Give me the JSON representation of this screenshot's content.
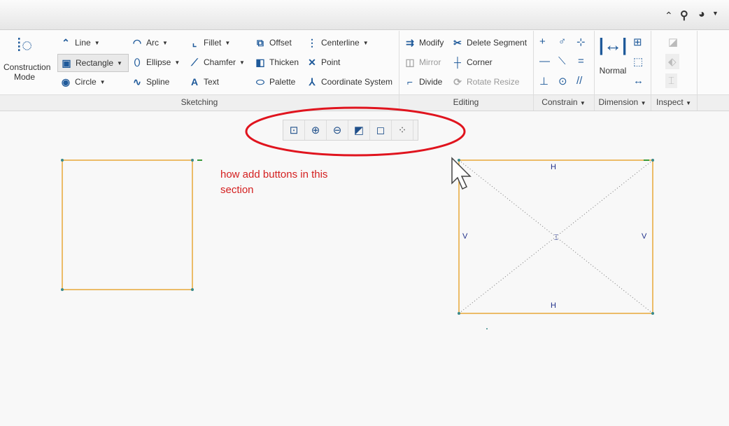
{
  "topbar": {
    "icons": [
      "collapse-ribbon-icon",
      "search-icon",
      "help-icon"
    ]
  },
  "ribbon": {
    "construction_mode": "Construction Mode",
    "sketching": {
      "label": "Sketching",
      "col1": [
        "Line",
        "Rectangle",
        "Circle"
      ],
      "col2": [
        "Arc",
        "Ellipse",
        "Spline"
      ],
      "col3": [
        "Fillet",
        "Chamfer",
        "Text"
      ],
      "col4": [
        "Offset",
        "Thicken",
        "Palette"
      ],
      "col5": [
        "Centerline",
        "Point",
        "Coordinate System"
      ]
    },
    "editing": {
      "label": "Editing",
      "items": [
        "Modify",
        "Delete Segment",
        "Mirror",
        "Corner",
        "Divide",
        "Rotate Resize"
      ]
    },
    "constrain": {
      "label": "Constrain"
    },
    "dimension": {
      "label": "Dimension",
      "normal": "Normal"
    },
    "inspect": {
      "label": "Inspect"
    }
  },
  "view_toolbar": {
    "buttons": [
      "refit",
      "zoom-in",
      "zoom-out",
      "repaint",
      "display-style",
      "sketcher-display"
    ]
  },
  "annotation": {
    "text": "how add buttons in this section",
    "ellipse_color": "#e0141e"
  },
  "canvas": {
    "constraints": {
      "h_top": "H",
      "h_bottom": "H",
      "v_left": "V",
      "v_right": "V"
    },
    "sketch_color": "#e8a838"
  }
}
